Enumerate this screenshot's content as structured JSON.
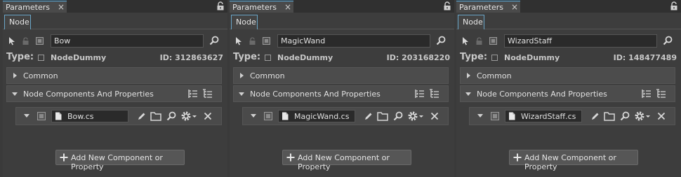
{
  "panels": [
    {
      "tab_title": "Parameters",
      "tab_close": "×",
      "node_tab": "Node",
      "node_name": "Bow",
      "type_label": "Type:",
      "type_value": "NodeDummy",
      "id_text": "ID: 312863627",
      "sections": {
        "common": "Common",
        "components": "Node Components And Properties"
      },
      "component_file": "Bow.cs",
      "add_button": "Add New Component or Property"
    },
    {
      "tab_title": "Parameters",
      "tab_close": "×",
      "node_tab": "Node",
      "node_name": "MagicWand",
      "type_label": "Type:",
      "type_value": "NodeDummy",
      "id_text": "ID: 203168220",
      "sections": {
        "common": "Common",
        "components": "Node Components And Properties"
      },
      "component_file": "MagicWand.cs",
      "add_button": "Add New Component or Property"
    },
    {
      "tab_title": "Parameters",
      "tab_close": "×",
      "node_tab": "Node",
      "node_name": "WizardStaff",
      "type_label": "Type:",
      "type_value": "NodeDummy",
      "id_text": "ID: 148477489",
      "sections": {
        "common": "Common",
        "components": "Node Components And Properties"
      },
      "component_file": "WizardStaff.cs",
      "add_button": "Add New Component or Property"
    }
  ],
  "colors": {
    "accent": "#5ab0e0",
    "panel_bg": "#3d3d3d",
    "section_bg": "#4c4c4c",
    "input_bg": "#2a2a2a"
  },
  "icons": [
    "select-arrow-icon",
    "lock-icon",
    "checkbox-icon",
    "search-icon",
    "expand-all-icon",
    "collapse-all-icon",
    "file-icon",
    "edit-pencil-icon",
    "folder-icon",
    "gear-icon",
    "close-icon",
    "plus-icon"
  ]
}
